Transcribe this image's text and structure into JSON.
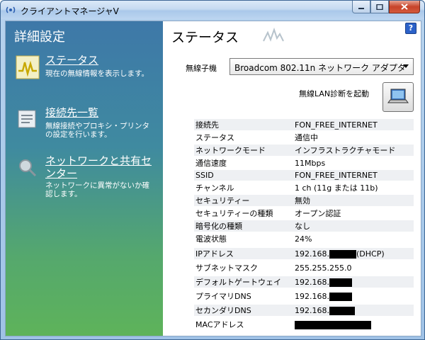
{
  "window": {
    "title": "クライアントマネージャV"
  },
  "sidebar": {
    "title": "詳細設定",
    "items": [
      {
        "label": "ステータス",
        "desc": "現在の無線情報を表示します。",
        "icon": "status-wave-icon"
      },
      {
        "label": "接続先一覧",
        "desc": "無線接続やプロキシ・プリンタの設定を行います。",
        "icon": "list-icon"
      },
      {
        "label": "ネットワークと共有センター",
        "desc": "ネットワークに異常がないか確認します。",
        "icon": "magnifier-icon"
      }
    ]
  },
  "main": {
    "title": "ステータス",
    "help": "?",
    "adapter_label": "無線子機",
    "adapter_value": "Broadcom 802.11n ネットワーク アダプタ",
    "diag_label": "無線LAN診断を起動",
    "status": [
      {
        "k": "接続先",
        "v": "FON_FREE_INTERNET"
      },
      {
        "k": "ステータス",
        "v": "通信中"
      },
      {
        "k": "ネットワークモード",
        "v": "インフラストラクチャモード"
      },
      {
        "k": "通信速度",
        "v": "11Mbps"
      },
      {
        "k": "SSID",
        "v": "FON_FREE_INTERNET"
      },
      {
        "k": "チャンネル",
        "v": "1 ch (11g または 11b)"
      },
      {
        "k": "セキュリティー",
        "v": "無効"
      },
      {
        "k": "セキュリティーの種類",
        "v": "オープン認証"
      },
      {
        "k": "暗号化の種類",
        "v": "なし"
      },
      {
        "k": "電波状態",
        "v": "24%"
      }
    ],
    "ip": [
      {
        "k": "IPアドレス",
        "v": "192.168.",
        "suffix": "(DHCP)"
      },
      {
        "k": "サブネットマスク",
        "v": "255.255.255.0",
        "suffix": ""
      },
      {
        "k": "デフォルトゲートウェイ",
        "v": "192.168.",
        "suffix": ""
      },
      {
        "k": "プライマリDNS",
        "v": "192.168.",
        "suffix": ""
      },
      {
        "k": "セカンダリDNS",
        "v": "192.168.",
        "suffix": ""
      },
      {
        "k": "MACアドレス",
        "v": "",
        "suffix": ""
      }
    ]
  }
}
